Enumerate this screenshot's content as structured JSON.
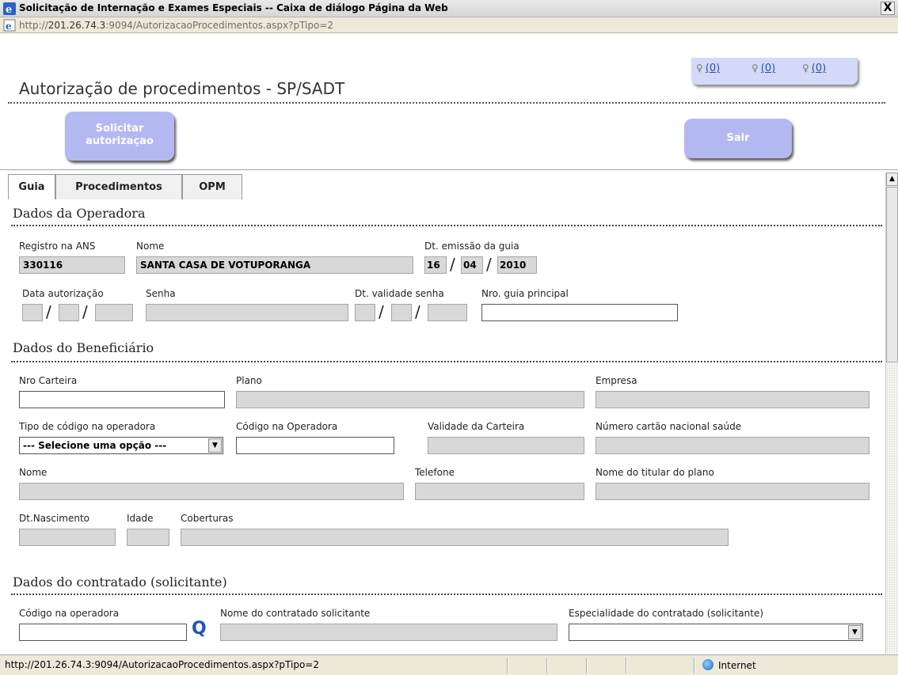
{
  "window": {
    "title": "Solicitação de Internação e Exames Especiais -- Caixa de diálogo Página da Web",
    "close_label": "X",
    "url_prefix": "http://",
    "url_host": "201.26.74.3",
    "url_rest": ":9094/AutorizacaoProcedimentos.aspx?pTipo=2"
  },
  "header": {
    "page_title": "Autorização de procedimentos - SP/SADT",
    "notifications": [
      "(0)",
      "(0)",
      "(0)"
    ],
    "solicitar_button": "Solicitar autorizaçao",
    "sair_button": "Sair"
  },
  "tabs": [
    "Guia",
    "Procedimentos",
    "OPM"
  ],
  "operadora": {
    "section_title": "Dados da Operadora",
    "registro_label": "Registro na ANS",
    "registro_value": "330116",
    "nome_label": "Nome",
    "nome_value": "SANTA CASA DE VOTUPORANGA",
    "emissao_label": "Dt. emissão da guia",
    "emissao_day": "16",
    "emissao_month": "04",
    "emissao_year": "2010",
    "data_autorizacao_label": "Data autorização",
    "senha_label": "Senha",
    "validade_senha_label": "Dt. validade senha",
    "guia_principal_label": "Nro. guia principal",
    "slash": "/"
  },
  "beneficiario": {
    "section_title": "Dados do Beneficiário",
    "carteira_label": "Nro Carteira",
    "plano_label": "Plano",
    "empresa_label": "Empresa",
    "tipo_codigo_label": "Tipo de código na operadora",
    "tipo_codigo_value": "--- Selecione uma opção ---",
    "codigo_operadora_label": "Código na Operadora",
    "validade_carteira_label": "Validade da Carteira",
    "cartao_nacional_label": "Número cartão nacional saúde",
    "nome_label": "Nome",
    "telefone_label": "Telefone",
    "titular_label": "Nome do titular do plano",
    "nascimento_label": "Dt.Nascimento",
    "idade_label": "Idade",
    "coberturas_label": "Coberturas"
  },
  "contratado": {
    "section_title": "Dados do contratado (solicitante)",
    "codigo_label": "Código na operadora",
    "nome_label": "Nome do contratado solicitante",
    "especialidade_label": "Especialidade do contratado (solicitante)"
  },
  "statusbar": {
    "text": "http://201.26.74.3:9094/AutorizacaoProcedimentos.aspx?pTipo=2",
    "zone": "Internet"
  }
}
